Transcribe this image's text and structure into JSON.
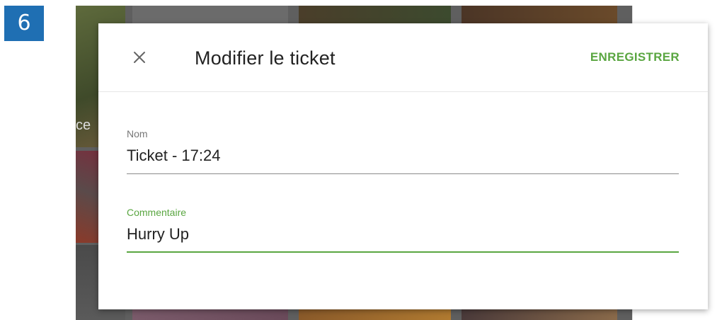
{
  "step_badge": "6",
  "dialog": {
    "title": "Modifier le ticket",
    "save_label": "ENREGISTRER",
    "close_icon": "close-icon",
    "fields": {
      "name": {
        "label": "Nom",
        "value": "Ticket - 17:24"
      },
      "comment": {
        "label": "Commentaire",
        "value": "Hurry Up"
      }
    }
  },
  "background": {
    "left_fragment": "ce"
  },
  "colors": {
    "accent": "#5aa641",
    "badge": "#1f6fb3",
    "overlay": "#5f5f5f"
  }
}
